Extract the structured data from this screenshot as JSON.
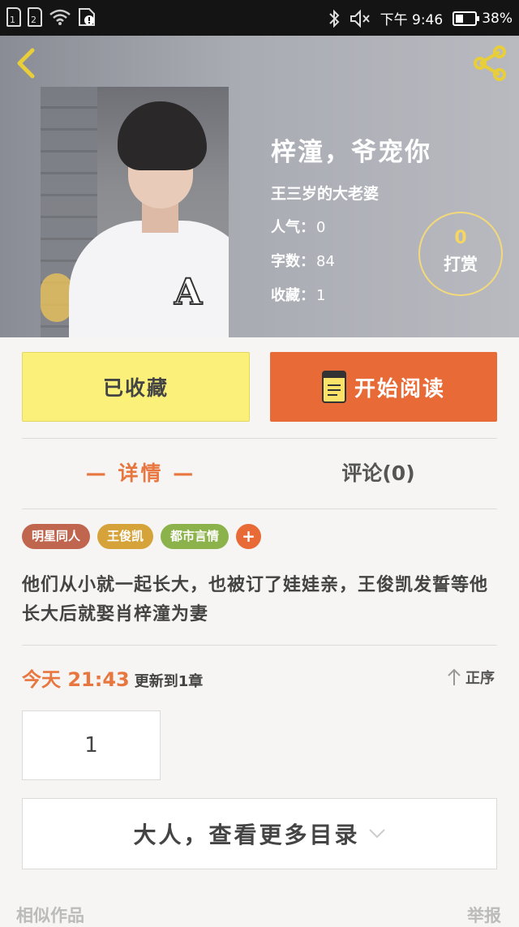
{
  "status_bar": {
    "sim1": "1",
    "sim2": "2",
    "time": "下午 9:46",
    "battery": "38%",
    "icons": [
      "sim1-icon",
      "sim2-icon",
      "wifi-icon",
      "sd-alert-icon",
      "bluetooth-icon",
      "mute-icon",
      "battery-icon"
    ]
  },
  "book": {
    "title": "梓潼，爷宠你",
    "author": "王三岁的大老婆",
    "popularity_label": "人气：",
    "popularity": "0",
    "words_label": "字数：",
    "words": "84",
    "favorites_label": "收藏：",
    "favorites": "1",
    "reward_count": "0",
    "reward_label": "打赏"
  },
  "actions": {
    "favorited_label": "已收藏",
    "read_label": "开始阅读"
  },
  "tabs": {
    "detail": "— 详情 —",
    "comments": "评论(0)"
  },
  "tags": [
    {
      "label": "明星同人",
      "color": "#c0664e"
    },
    {
      "label": "王俊凯",
      "color": "#d6a23a"
    },
    {
      "label": "都市言情",
      "color": "#8cb34b"
    }
  ],
  "tag_add": "+",
  "description": "他们从小就一起长大，也被订了娃娃亲，王俊凯发誓等他长大后就娶肖梓潼为妻",
  "update": {
    "time": "今天 21:43",
    "suffix": "更新到1章",
    "sort_label": "正序"
  },
  "chapters": [
    "1"
  ],
  "more_catalog": "大人，查看更多目录",
  "footer": {
    "similar": "相似作品",
    "report": "举报"
  },
  "colors": {
    "accent": "#e86a36",
    "favorite_bg": "#fbf17a",
    "reward_ring": "#f3d97a"
  }
}
